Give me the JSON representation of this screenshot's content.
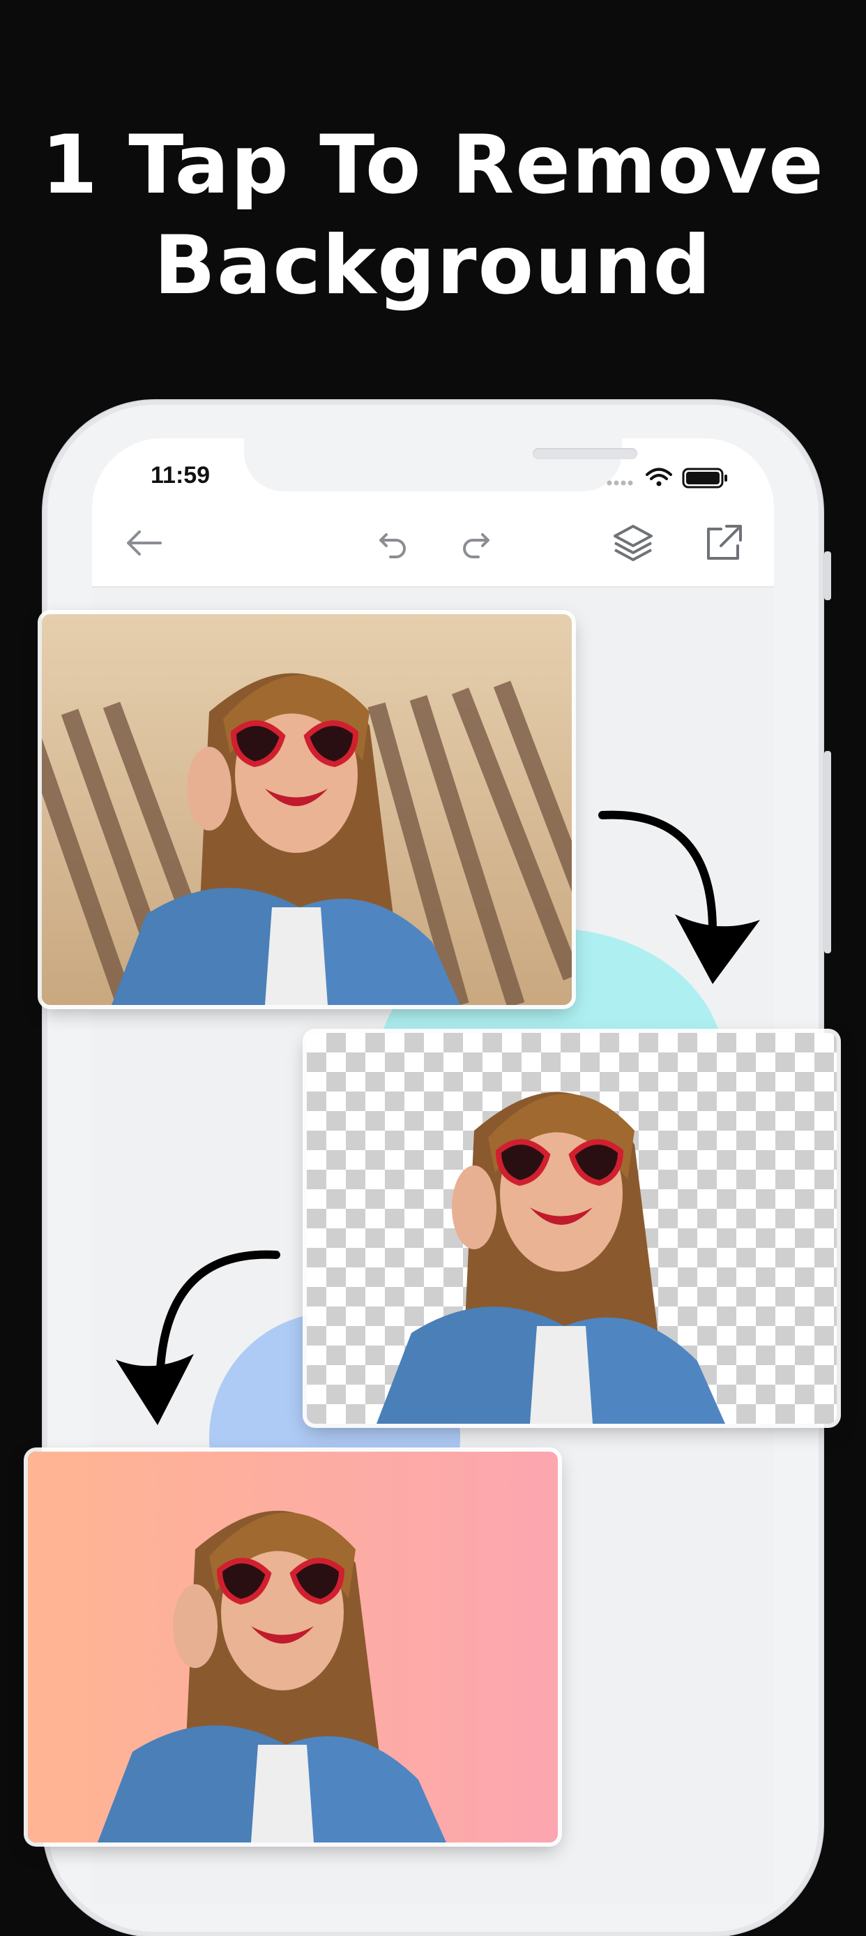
{
  "headline": {
    "line1": "1 Tap To Remove",
    "line2": "Background"
  },
  "status_bar": {
    "time": "11:59",
    "icons": [
      "signal-dots-icon",
      "wifi-icon",
      "battery-icon"
    ]
  },
  "toolbar": {
    "icons": [
      "back-arrow-icon",
      "undo-icon",
      "redo-icon",
      "layers-icon",
      "share-icon"
    ]
  },
  "illustration": {
    "steps": [
      "original-photo",
      "background-removed-photo",
      "new-background-photo"
    ],
    "accent_colors": {
      "cyan_blob": "#aef0f2",
      "blue_blob": "#aecbf5",
      "gradient_start": "#ffb592",
      "gradient_end": "#fca6b0"
    }
  }
}
